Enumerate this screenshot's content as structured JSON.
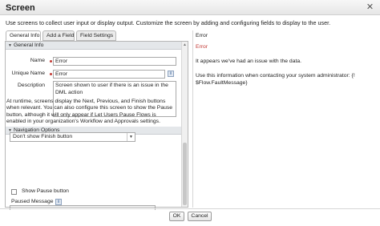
{
  "window": {
    "title": "Screen"
  },
  "intro_text": "Use screens to collect user input or display output. Customize the screen by adding and configuring fields to display to the user.",
  "tabs": [
    {
      "label": "General Info",
      "active": true
    },
    {
      "label": "Add a Field",
      "active": false
    },
    {
      "label": "Field Settings",
      "active": false
    }
  ],
  "general_info": {
    "header": "General Info",
    "name_label": "Name",
    "name_value": "Error",
    "unique_name_label": "Unique Name",
    "unique_name_value": "Error",
    "description_label": "Description",
    "description_value": "Screen shown to user if there is an issue in the DML action",
    "info_badge": "i"
  },
  "navigation_options": {
    "header": "Navigation Options",
    "description": "At runtime, screens display the Next, Previous, and Finish buttons when relevant. You can also configure this screen to show the Pause button, although it will only appear if Let Users Pause Flows is enabled in your organization's Workflow and Approvals settings.",
    "finish_select_value": "Don't show Finish button",
    "show_pause_label": "Show Pause button",
    "show_pause_checked": false,
    "paused_message_label": "Paused Message",
    "info_badge": "i"
  },
  "preview": {
    "line1": "Error",
    "line2": "Error",
    "line3": "It appears we've had an issue with the data.",
    "line4": "Use this information when contacting your system administrator: {!",
    "line5": "$Flow.FaultMessage}"
  },
  "footer": {
    "ok_label": "OK",
    "cancel_label": "Cancel"
  },
  "colors": {
    "required": "#c23934",
    "error_text": "#c23934",
    "header_bg": "#e4e7ea"
  },
  "icons": {
    "close": "close-icon",
    "collapse": "triangle-down-icon",
    "dropdown": "chevron-down-icon",
    "info": "info-icon"
  }
}
